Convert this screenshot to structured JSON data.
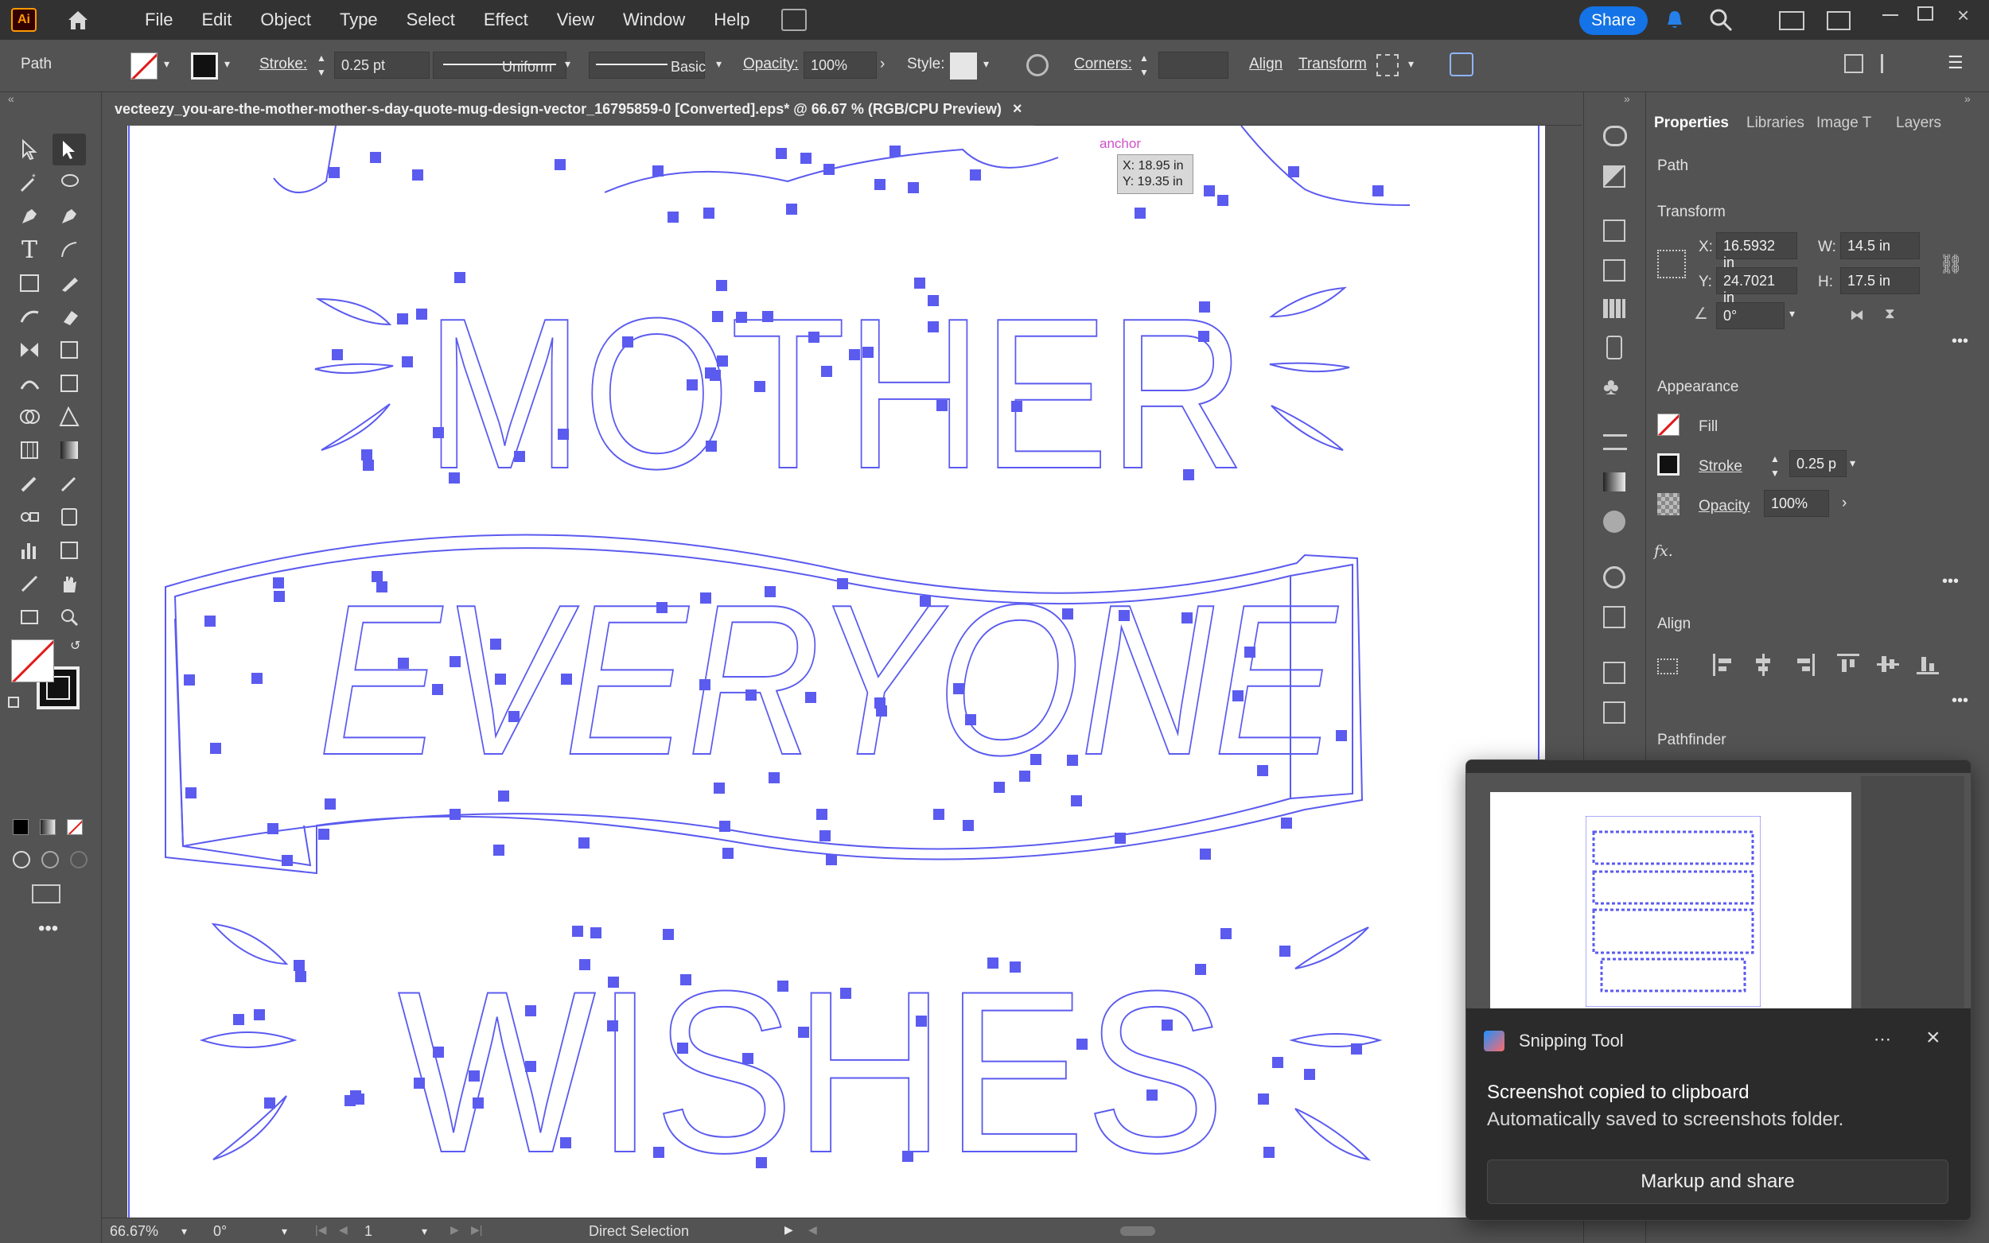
{
  "menubar": {
    "logo": "Ai",
    "items": [
      "File",
      "Edit",
      "Object",
      "Type",
      "Select",
      "Effect",
      "View",
      "Window",
      "Help"
    ],
    "share_label": "Share"
  },
  "controlbar": {
    "selection_type": "Path",
    "stroke_label": "Stroke:",
    "stroke_value": "0.25 pt",
    "profile_label": "Uniform",
    "brush_label": "Basic",
    "opacity_label": "Opacity:",
    "opacity_value": "100%",
    "style_label": "Style:",
    "corners_label": "Corners:",
    "align_label": "Align",
    "transform_label": "Transform"
  },
  "document": {
    "tab_title": "vecteezy_you-are-the-mother-mother-s-day-quote-mug-design-vector_16795859-0 [Converted].eps* @ 66.67 % (RGB/CPU Preview)"
  },
  "canvas": {
    "words": [
      "MOTHER",
      "EVERYONE",
      "WISHES"
    ],
    "smart_guide_label": "anchor",
    "tooltip_x": "X: 18.95 in",
    "tooltip_y": "Y: 19.35 in",
    "path_color": "#5b5bf0"
  },
  "panel": {
    "tabs": [
      "Properties",
      "Libraries",
      "Image T",
      "Layers"
    ],
    "active_tab": "Properties",
    "object_type": "Path",
    "transform_title": "Transform",
    "x_label": "X:",
    "x_value": "16.5932 in",
    "y_label": "Y:",
    "y_value": "24.7021 in",
    "w_label": "W:",
    "w_value": "14.5 in",
    "h_label": "H:",
    "h_value": "17.5 in",
    "angle_value": "0°",
    "appearance_title": "Appearance",
    "fill_label": "Fill",
    "stroke_label": "Stroke",
    "stroke_value": "0.25 p",
    "opacity_label": "Opacity",
    "opacity_value": "100%",
    "fx_label": "fx.",
    "align_title": "Align",
    "pathfinder_title": "Pathfinder"
  },
  "statusbar": {
    "zoom": "66.67%",
    "rotation": "0°",
    "artboard_num": "1",
    "tool_name": "Direct Selection"
  },
  "toast": {
    "app_name": "Snipping Tool",
    "title": "Screenshot copied to clipboard",
    "subtitle": "Automatically saved to screenshots folder.",
    "button_label": "Markup and share",
    "more_icon": "more-icon",
    "close_icon": "close-icon"
  },
  "colors": {
    "accent_blue": "#1473e6",
    "logo_orange": "#ff9a00"
  }
}
